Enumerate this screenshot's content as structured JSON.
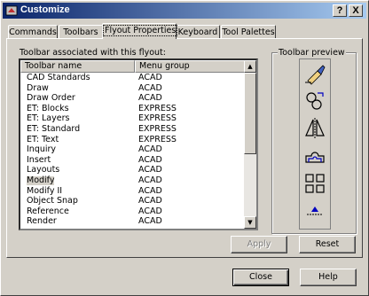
{
  "window": {
    "title": "Customize"
  },
  "title_buttons": {
    "help": "?",
    "close": "X"
  },
  "tabs": [
    {
      "label": "Commands"
    },
    {
      "label": "Toolbars"
    },
    {
      "label": "Flyout Properties"
    },
    {
      "label": "Keyboard"
    },
    {
      "label": "Tool Palettes"
    }
  ],
  "active_tab": "Flyout Properties",
  "list_label": "Toolbar associated with this flyout:",
  "columns": {
    "name": "Toolbar name",
    "group": "Menu group"
  },
  "rows": [
    {
      "name": "CAD Standards",
      "group": "ACAD"
    },
    {
      "name": "Draw",
      "group": "ACAD"
    },
    {
      "name": "Draw Order",
      "group": "ACAD"
    },
    {
      "name": "ET: Blocks",
      "group": "EXPRESS"
    },
    {
      "name": "ET: Layers",
      "group": "EXPRESS"
    },
    {
      "name": "ET: Standard",
      "group": "EXPRESS"
    },
    {
      "name": "ET: Text",
      "group": "EXPRESS"
    },
    {
      "name": "Inquiry",
      "group": "ACAD"
    },
    {
      "name": "Insert",
      "group": "ACAD"
    },
    {
      "name": "Layouts",
      "group": "ACAD"
    },
    {
      "name": "Modify",
      "group": "ACAD"
    },
    {
      "name": "Modify II",
      "group": "ACAD"
    },
    {
      "name": "Object Snap",
      "group": "ACAD"
    },
    {
      "name": "Reference",
      "group": "ACAD"
    },
    {
      "name": "Render",
      "group": "ACAD"
    }
  ],
  "selected_row": "Modify",
  "preview": {
    "label": "Toolbar preview",
    "icons": [
      "erase-icon",
      "copy-icon",
      "mirror-icon",
      "offset-icon",
      "array-icon",
      "move-icon"
    ]
  },
  "buttons": {
    "apply": "Apply",
    "reset": "Reset",
    "close": "Close",
    "help": "Help"
  },
  "colors": {
    "title_start": "#0a246a",
    "title_end": "#a6caf0",
    "face": "#d4d0c8"
  }
}
